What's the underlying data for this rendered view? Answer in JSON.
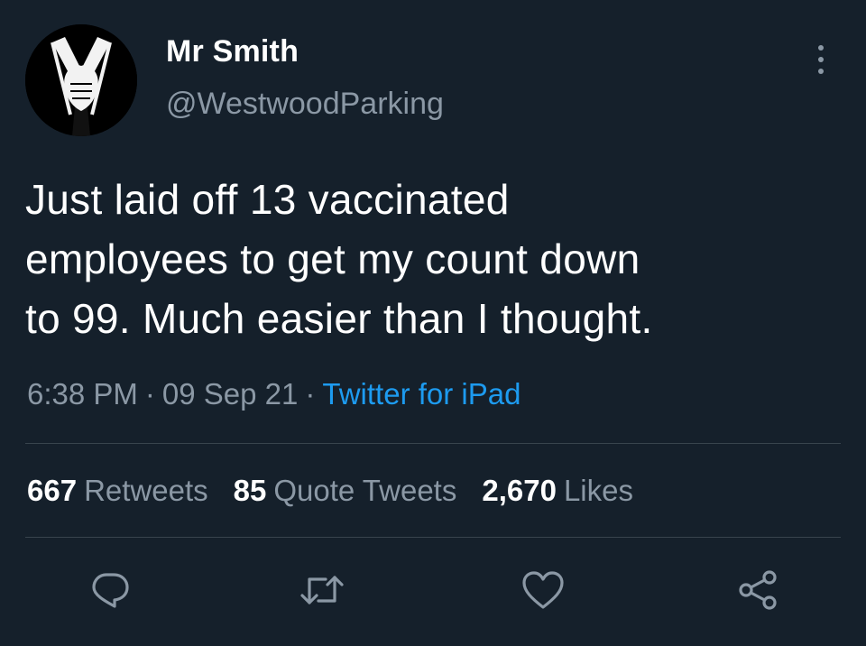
{
  "user": {
    "name": "Mr Smith",
    "handle": "@WestwoodParking",
    "avatar_icon": "suit-tie-avatar"
  },
  "tweet": {
    "lines": [
      "Just laid off 13 vaccinated",
      "employees to get my count down",
      "to 99. Much easier than I thought."
    ],
    "time": "6:38 PM",
    "date": "09 Sep 21",
    "separator": "·",
    "source": "Twitter for iPad"
  },
  "stats": {
    "retweets_count": "667",
    "retweets_label": "Retweets",
    "quotes_count": "85",
    "quotes_label": "Quote Tweets",
    "likes_count": "2,670",
    "likes_label": "Likes"
  },
  "actions": [
    "reply-icon",
    "retweet-icon",
    "like-icon",
    "share-icon"
  ],
  "colors": {
    "background": "#15202b",
    "text": "#ffffff",
    "secondary": "#8b98a5",
    "accent": "#1d9bf0",
    "divider": "#38444d"
  }
}
